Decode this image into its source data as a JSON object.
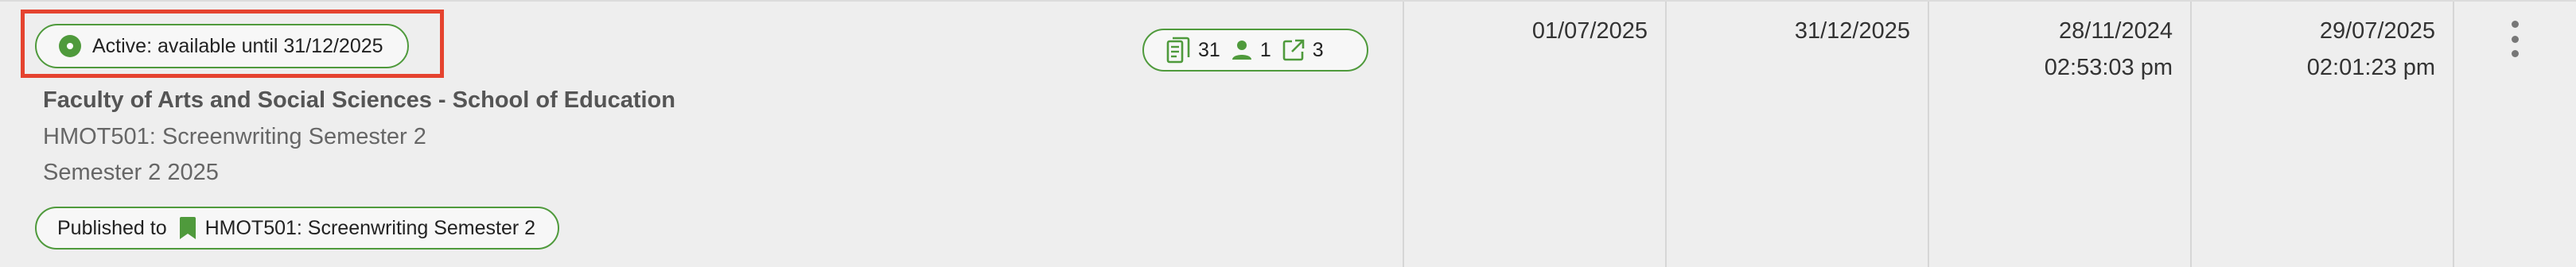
{
  "status": {
    "label": "Active: available until 31/12/2025"
  },
  "stats": {
    "documents_count": "31",
    "users_count": "1",
    "links_count": "3"
  },
  "course": {
    "faculty": "Faculty of Arts and Social Sciences - School of Education",
    "name": "HMOT501: Screenwriting Semester 2",
    "semester": "Semester 2 2025"
  },
  "published": {
    "prefix": "Published to",
    "target": "HMOT501: Screenwriting Semester 2"
  },
  "columns": {
    "start_date": "01/07/2025",
    "end_date": "31/12/2025",
    "created_date": "28/11/2024",
    "created_time": "02:53:03 pm",
    "modified_date": "29/07/2025",
    "modified_time": "02:01:23 pm"
  },
  "colors": {
    "accent_green": "#4f9a3c",
    "highlight_red": "#e5432f",
    "row_background": "#eeeeee"
  },
  "icons": {
    "status": "status-dot-icon",
    "documents": "document-list-icon",
    "users": "person-icon",
    "links": "external-link-icon",
    "published": "bookmark-icon",
    "more": "more-vertical-icon"
  }
}
